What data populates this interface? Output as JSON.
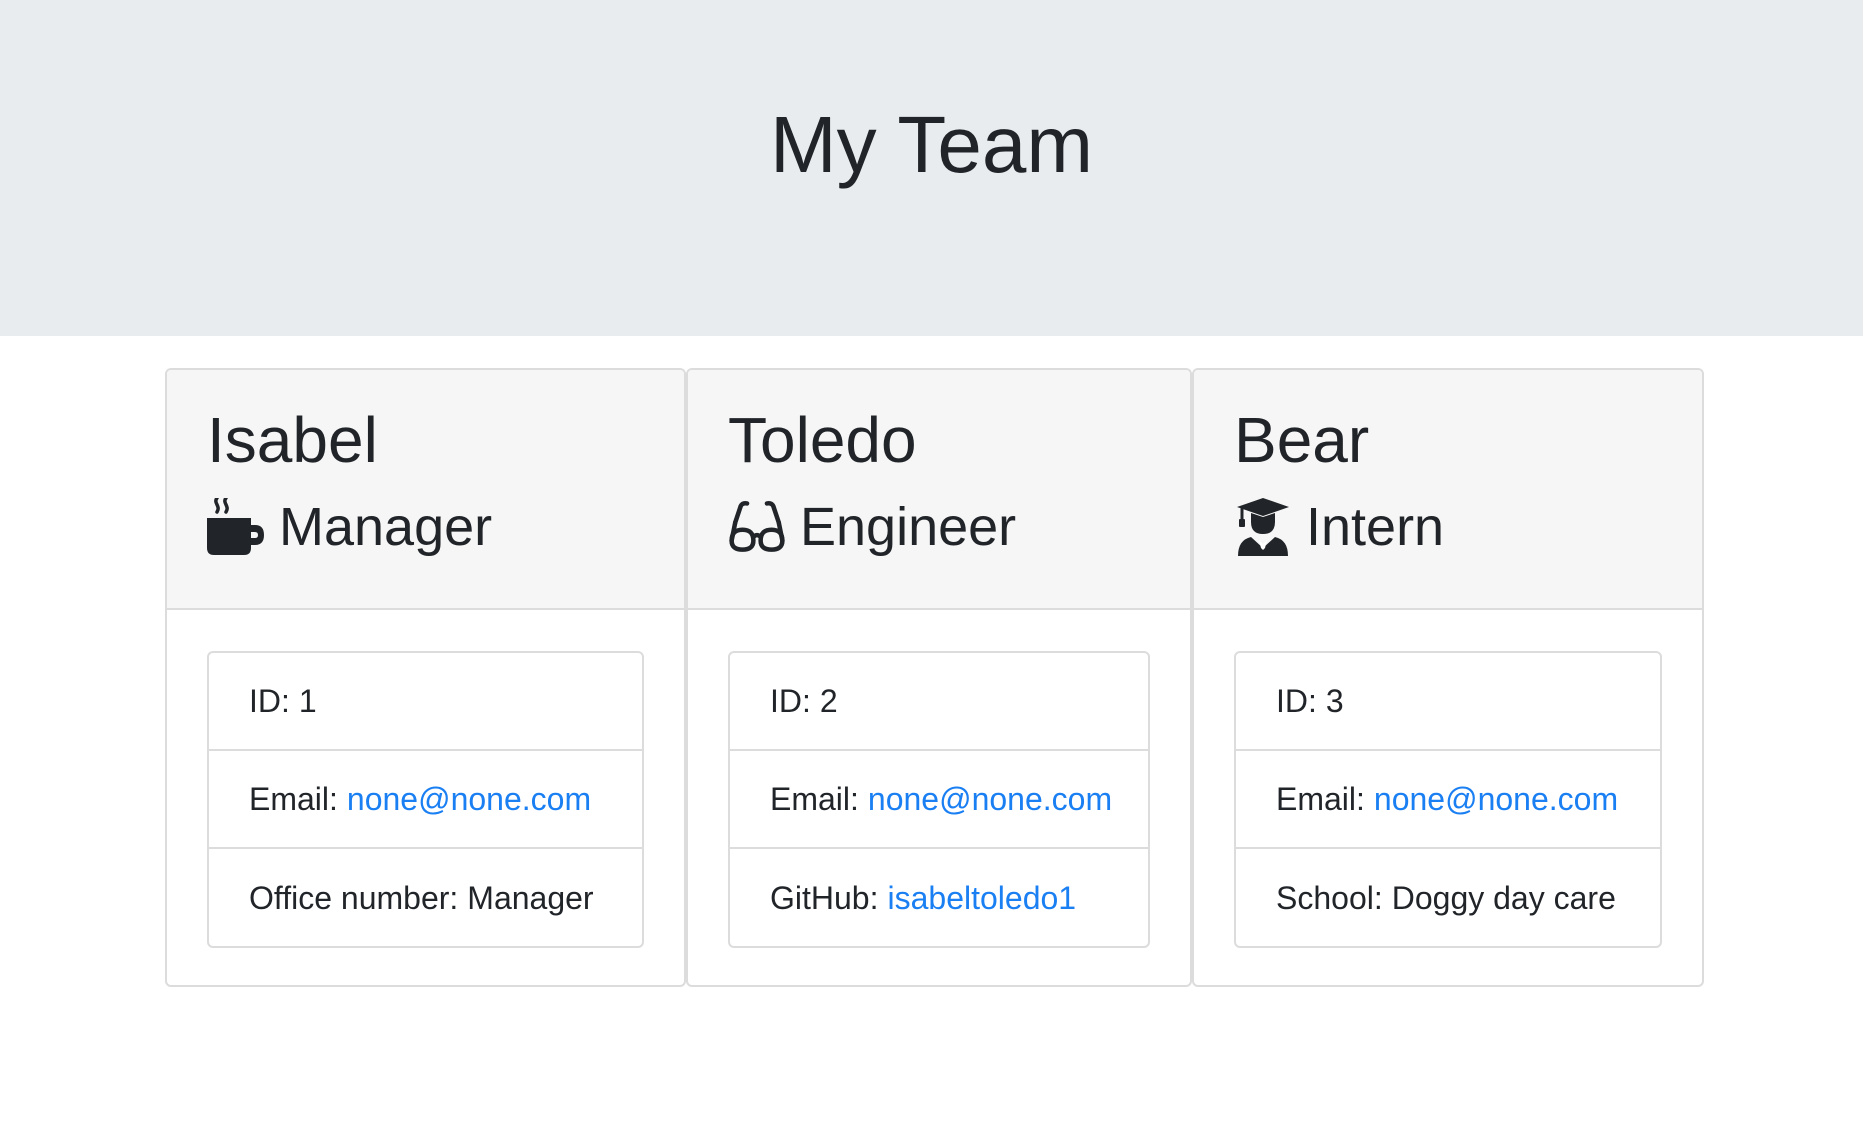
{
  "header": {
    "title": "My Team"
  },
  "colors": {
    "header_bg": "#e9ecef",
    "link": "#1a7ff2",
    "card_header_bg": "#f6f6f6",
    "text": "#212529"
  },
  "cards": [
    {
      "name": "Isabel",
      "role": "Manager",
      "icon": "coffee-mug-icon",
      "id_label": "ID:",
      "id_value": "1",
      "email_label": "Email:",
      "email": "none@none.com",
      "extra_label": "Office number:",
      "extra_value": "Manager"
    },
    {
      "name": "Toledo",
      "role": "Engineer",
      "icon": "glasses-icon",
      "id_label": "ID:",
      "id_value": "2",
      "email_label": "Email:",
      "email": "none@none.com",
      "extra_label": "GitHub:",
      "extra_value": "isabeltoledo1"
    },
    {
      "name": "Bear",
      "role": "Intern",
      "icon": "graduate-icon",
      "id_label": "ID:",
      "id_value": "3",
      "email_label": "Email:",
      "email": "none@none.com",
      "extra_label": "School:",
      "extra_value": "Doggy day care"
    }
  ]
}
